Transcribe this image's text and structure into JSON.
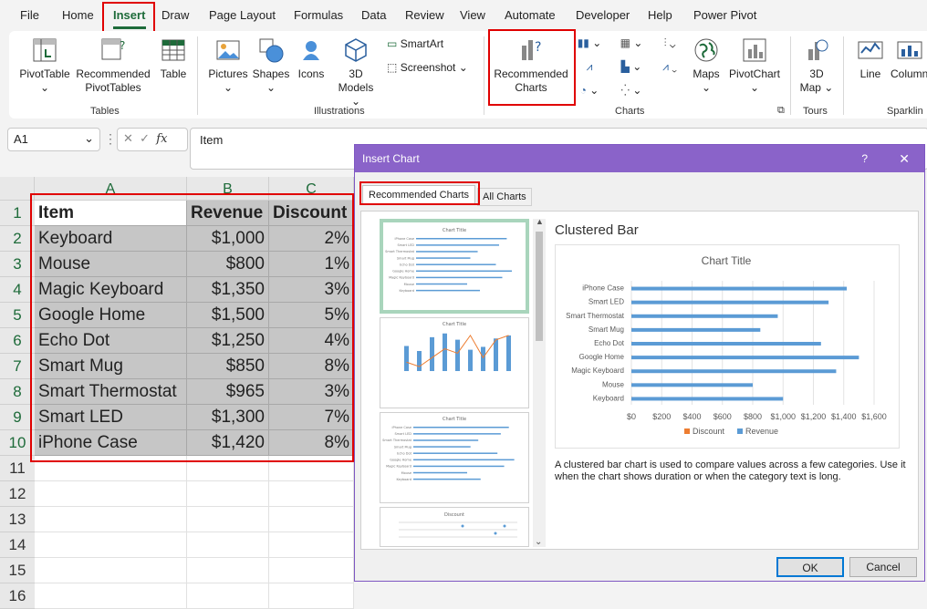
{
  "ribbon_tabs": [
    "File",
    "Home",
    "Insert",
    "Draw",
    "Page Layout",
    "Formulas",
    "Data",
    "Review",
    "View",
    "Automate",
    "Developer",
    "Help",
    "Power Pivot"
  ],
  "ribbon": {
    "tables": {
      "pivottable": "PivotTable",
      "recommended_pivot_1": "Recommended",
      "recommended_pivot_2": "PivotTables",
      "table": "Table",
      "group": "Tables"
    },
    "illustrations": {
      "pictures": "Pictures",
      "shapes": "Shapes",
      "icons": "Icons",
      "models_1": "3D",
      "models_2": "Models",
      "smartart": "SmartArt",
      "screenshot": "Screenshot",
      "group": "Illustrations"
    },
    "charts": {
      "recommended_1": "Recommended",
      "recommended_2": "Charts",
      "maps": "Maps",
      "pivotchart": "PivotChart",
      "group": "Charts"
    },
    "tours": {
      "map_1": "3D",
      "map_2": "Map",
      "group": "Tours"
    },
    "sparklines": {
      "line": "Line",
      "column": "Column",
      "group": "Sparklin"
    }
  },
  "formula_bar": {
    "name_box": "A1",
    "fx": "fx",
    "value": "Item"
  },
  "columns": [
    "A",
    "B",
    "C"
  ],
  "rows": [
    "1",
    "2",
    "3",
    "4",
    "5",
    "6",
    "7",
    "8",
    "9",
    "10",
    "11",
    "12",
    "13",
    "14",
    "15",
    "16"
  ],
  "sheet": {
    "headers": [
      "Item",
      "Revenue",
      "Discount"
    ],
    "data": [
      [
        "Keyboard",
        "$1,000",
        "2%"
      ],
      [
        "Mouse",
        "$800",
        "1%"
      ],
      [
        "Magic Keyboard",
        "$1,350",
        "3%"
      ],
      [
        "Google Home",
        "$1,500",
        "5%"
      ],
      [
        "Echo Dot",
        "$1,250",
        "4%"
      ],
      [
        "Smart Mug",
        "$850",
        "8%"
      ],
      [
        "Smart Thermostat",
        "$965",
        "3%"
      ],
      [
        "Smart LED",
        "$1,300",
        "7%"
      ],
      [
        "iPhone Case",
        "$1,420",
        "8%"
      ]
    ]
  },
  "dialog": {
    "title": "Insert Chart",
    "help": "?",
    "close": "✕",
    "tab_recommended": "Recommended Charts",
    "tab_all": "All Charts",
    "preview_heading": "Clustered Bar",
    "description": "A clustered bar chart is used to compare values across a few categories. Use it when the chart shows duration or when the category text is long.",
    "ok": "OK",
    "cancel": "Cancel",
    "thumb_discount_title": "Discount"
  },
  "chart_data": {
    "type": "bar",
    "title": "Chart Title",
    "categories": [
      "iPhone Case",
      "Smart LED",
      "Smart Thermostat",
      "Smart Mug",
      "Echo Dot",
      "Google Home",
      "Magic Keyboard",
      "Mouse",
      "Keyboard"
    ],
    "series": [
      {
        "name": "Discount",
        "values": [
          0.08,
          0.07,
          0.03,
          0.08,
          0.04,
          0.05,
          0.03,
          0.01,
          0.02
        ],
        "color": "#ed7d31"
      },
      {
        "name": "Revenue",
        "values": [
          1420,
          1300,
          965,
          850,
          1250,
          1500,
          1350,
          800,
          1000
        ],
        "color": "#5b9bd5"
      }
    ],
    "x_ticks": [
      "$0",
      "$200",
      "$400",
      "$600",
      "$800",
      "$1,000",
      "$1,200",
      "$1,400",
      "$1,600"
    ],
    "xlim": [
      0,
      1600
    ],
    "legend": "bottom",
    "grid": true
  },
  "colors": {
    "accent": "#1e6b3a",
    "dialog_title": "#8a63c9",
    "highlight": "#e00000"
  }
}
